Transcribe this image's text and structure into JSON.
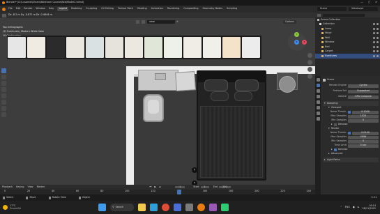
{
  "window": {
    "title": "Blender* [D:\\Lusamei\\Dream\\Bedroom Course\\Bed\\Model2.blend]"
  },
  "menubar": {
    "items": [
      "File",
      "Edit",
      "Render",
      "Window",
      "Help"
    ],
    "workspaces": [
      "Layout",
      "Modeling",
      "Sculpting",
      "UV Editing",
      "Texture Paint",
      "Shading",
      "Animation",
      "Rendering",
      "Compositing",
      "Geometry Nodes",
      "Scripting"
    ],
    "active_workspace": "Layout",
    "scene_label": "Scene",
    "view_layer_label": "ViewLayer"
  },
  "viewport": {
    "dimensions_text": "Dx -8.2 m   Dy -0.877 m   Dz -0.4644 m",
    "view_name": "Top Orthographic",
    "collection_info": "(3) Furnitures | Modern White Vase",
    "units": "10 Centimeters",
    "search_value": "vase",
    "options_label": "Options",
    "gizmo_x": "X",
    "gizmo_y": "Y",
    "gizmo_z": "Z",
    "axis_y_label": "y",
    "axis_x_label": "x"
  },
  "asset_strip": {
    "count": 13
  },
  "outliner": {
    "rows": [
      {
        "name": "Scene Collection"
      },
      {
        "name": "Collection"
      },
      {
        "name": "Lamp"
      },
      {
        "name": "Wood"
      },
      {
        "name": "Wall"
      },
      {
        "name": "Window"
      },
      {
        "name": "Bed"
      },
      {
        "name": "Carpet"
      },
      {
        "name": "Furnitures"
      }
    ]
  },
  "properties": {
    "object_label": "Scene",
    "render_engine_label": "Render Engine",
    "render_engine_value": "Cycles",
    "feature_set_label": "Feature Set",
    "feature_set_value": "Supported",
    "device_label": "Device",
    "device_value": "GPU Compute",
    "sampling_label": "Sampling",
    "viewport_label": "Viewport",
    "noise_threshold_label": "Noise Thresh.",
    "viewport_noise_value": "0.1000",
    "max_samples_label": "Max Samples",
    "viewport_max_samples": "1024",
    "min_samples_label": "Min Samples",
    "viewport_min_samples": "0",
    "denoise_label": "Denoise",
    "render_label": "Render",
    "render_noise_value": "0.0100",
    "render_max_samples": "4096",
    "render_min_samples": "0",
    "time_limit_label": "Time Limit",
    "time_limit_value": "0 sec",
    "render_denoise_label": "Denoise",
    "advanced_label": "Advanced",
    "light_paths_label": "Light Paths"
  },
  "timeline": {
    "playback_label": "Playback",
    "keying_label": "Keying",
    "view_label": "View",
    "marker_label": "Marker",
    "current_frame": "1",
    "start_label": "Start",
    "start_value": "1",
    "end_label": "End",
    "end_value": "250",
    "ticks": [
      "0",
      "20",
      "40",
      "60",
      "80",
      "100",
      "120",
      "140",
      "160",
      "180",
      "200",
      "220",
      "240"
    ]
  },
  "statusbar": {
    "left": "Select",
    "middle_items": [
      "Move",
      "Rotate View",
      "Object"
    ],
    "version": "3.3.1"
  },
  "taskbar": {
    "weather_temp": "17°C",
    "weather_text": "Ensoleillé",
    "search_label": "Search",
    "language": "ENG",
    "time": "16:14",
    "date": "28/11/2022"
  },
  "colors": {
    "accent_blue": "#4772b3",
    "wall": "#e9e9e9",
    "floor": "#3d3d3d",
    "bed_frame": "#2a2a2a"
  }
}
